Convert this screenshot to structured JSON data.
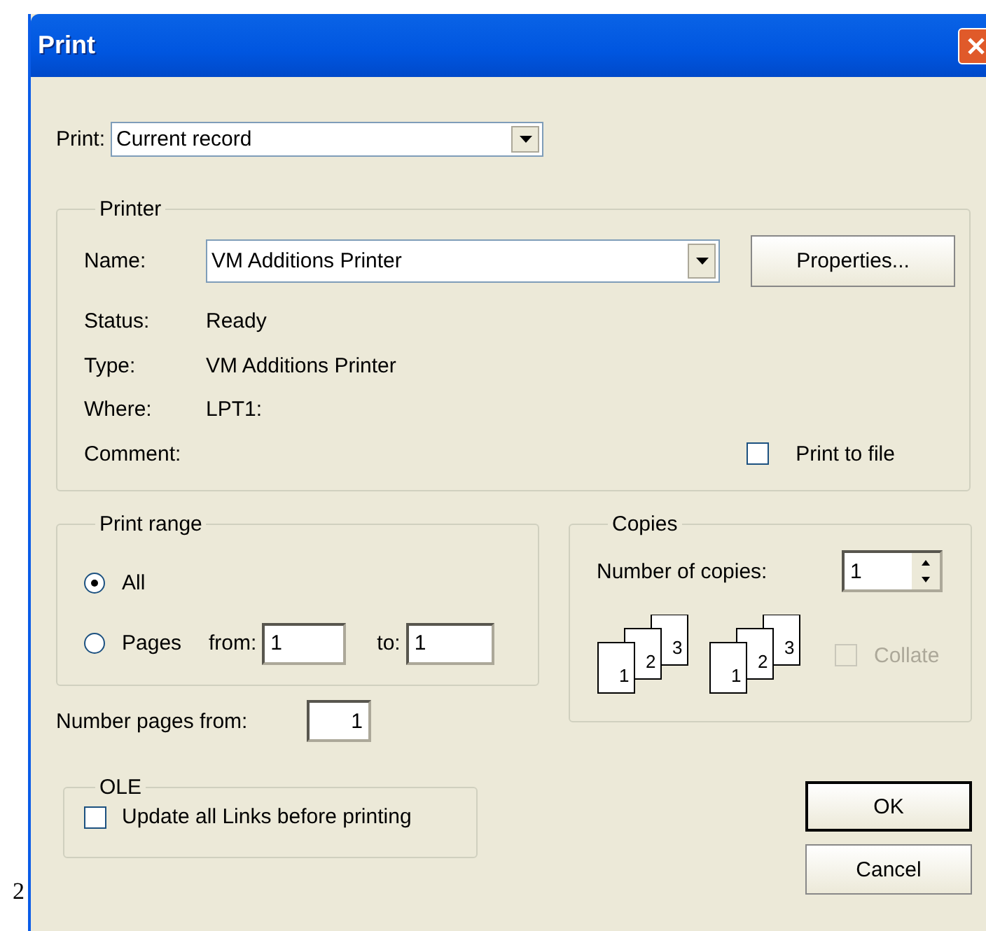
{
  "window": {
    "title": "Print"
  },
  "print_what": {
    "label": "Print:",
    "value": "Current record"
  },
  "printer": {
    "legend": "Printer",
    "name_label": "Name:",
    "name_value": "VM Additions Printer",
    "properties_button": "Properties...",
    "info": [
      {
        "label": "Status:",
        "value": "Ready"
      },
      {
        "label": "Type:",
        "value": "VM Additions Printer"
      },
      {
        "label": "Where:",
        "value": "LPT1:"
      },
      {
        "label": "Comment:"
      }
    ],
    "print_to_file": {
      "label": "Print to file",
      "checked": false
    }
  },
  "print_range": {
    "legend": "Print range",
    "options": [
      {
        "label": "All",
        "selected": true
      },
      {
        "label": "Pages",
        "selected": false
      }
    ],
    "from_label": "from:",
    "from_value": "1",
    "to_label": "to:",
    "to_value": "1"
  },
  "number_pages_from": {
    "label": "Number pages from:",
    "value": "1"
  },
  "ole": {
    "legend": "OLE",
    "update_links": {
      "label": "Update all Links before printing",
      "checked": false
    }
  },
  "copies": {
    "legend": "Copies",
    "number_label": "Number of copies:",
    "number_value": "1",
    "collate_icons": [
      [
        "1",
        "2",
        "3"
      ],
      [
        "1",
        "2",
        "3"
      ]
    ],
    "collate": {
      "label": "Collate",
      "checked": false,
      "disabled": true
    }
  },
  "buttons": [
    {
      "label": "OK",
      "default": true
    },
    {
      "label": "Cancel",
      "default": false
    }
  ],
  "page_number": "2"
}
